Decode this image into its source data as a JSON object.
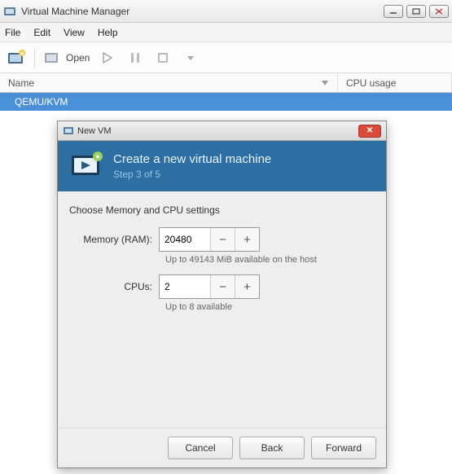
{
  "window": {
    "title": "Virtual Machine Manager"
  },
  "menu": {
    "file": "File",
    "edit": "Edit",
    "view": "View",
    "help": "Help"
  },
  "toolbar": {
    "open": "Open"
  },
  "columns": {
    "name": "Name",
    "cpu": "CPU usage"
  },
  "rows": {
    "conn": "QEMU/KVM"
  },
  "dialog": {
    "title": "New VM",
    "header_title": "Create a new virtual machine",
    "step": "Step 3 of 5",
    "section": "Choose Memory and CPU settings",
    "mem_label": "Memory (RAM):",
    "mem_value": "20480",
    "mem_hint": "Up to 49143 MiB available on the host",
    "cpu_label": "CPUs:",
    "cpu_value": "2",
    "cpu_hint": "Up to 8 available",
    "cancel": "Cancel",
    "back": "Back",
    "forward": "Forward"
  }
}
